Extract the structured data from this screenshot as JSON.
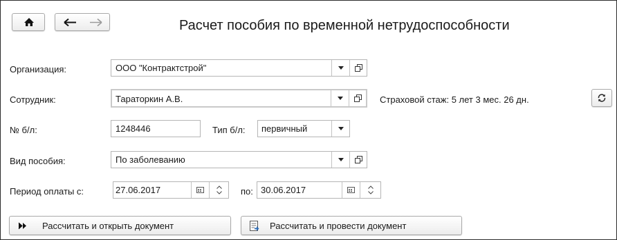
{
  "title": "Расчет пособия по временной нетрудоспособности",
  "nav": {
    "home_icon": "home-icon",
    "back_icon": "arrow-left-icon",
    "forward_icon": "arrow-right-icon"
  },
  "form": {
    "organization": {
      "label": "Организация:",
      "value": "ООО \"Контрактстрой\""
    },
    "employee": {
      "label": "Сотрудник:",
      "value": "Тараторкин А.В."
    },
    "insurance": {
      "text": "Страховой стаж: 5 лет 3 мес. 26 дн."
    },
    "sick_leave_no": {
      "label": "№ б/л:",
      "value": "1248446"
    },
    "sick_leave_type": {
      "label": "Тип б/л:",
      "value": "первичный"
    },
    "benefit_type": {
      "label": "Вид пособия:",
      "value": "По заболеванию"
    },
    "period": {
      "label_from": "Период оплаты с:",
      "from": "27.06.2017",
      "label_to": "по:",
      "to": "30.06.2017"
    }
  },
  "actions": {
    "calc_open": "Рассчитать и открыть документ",
    "calc_post": "Рассчитать и провести документ"
  },
  "colors": {
    "text": "#1a1a1a",
    "border": "#b5b5b5",
    "button_bg": "#ececec"
  }
}
